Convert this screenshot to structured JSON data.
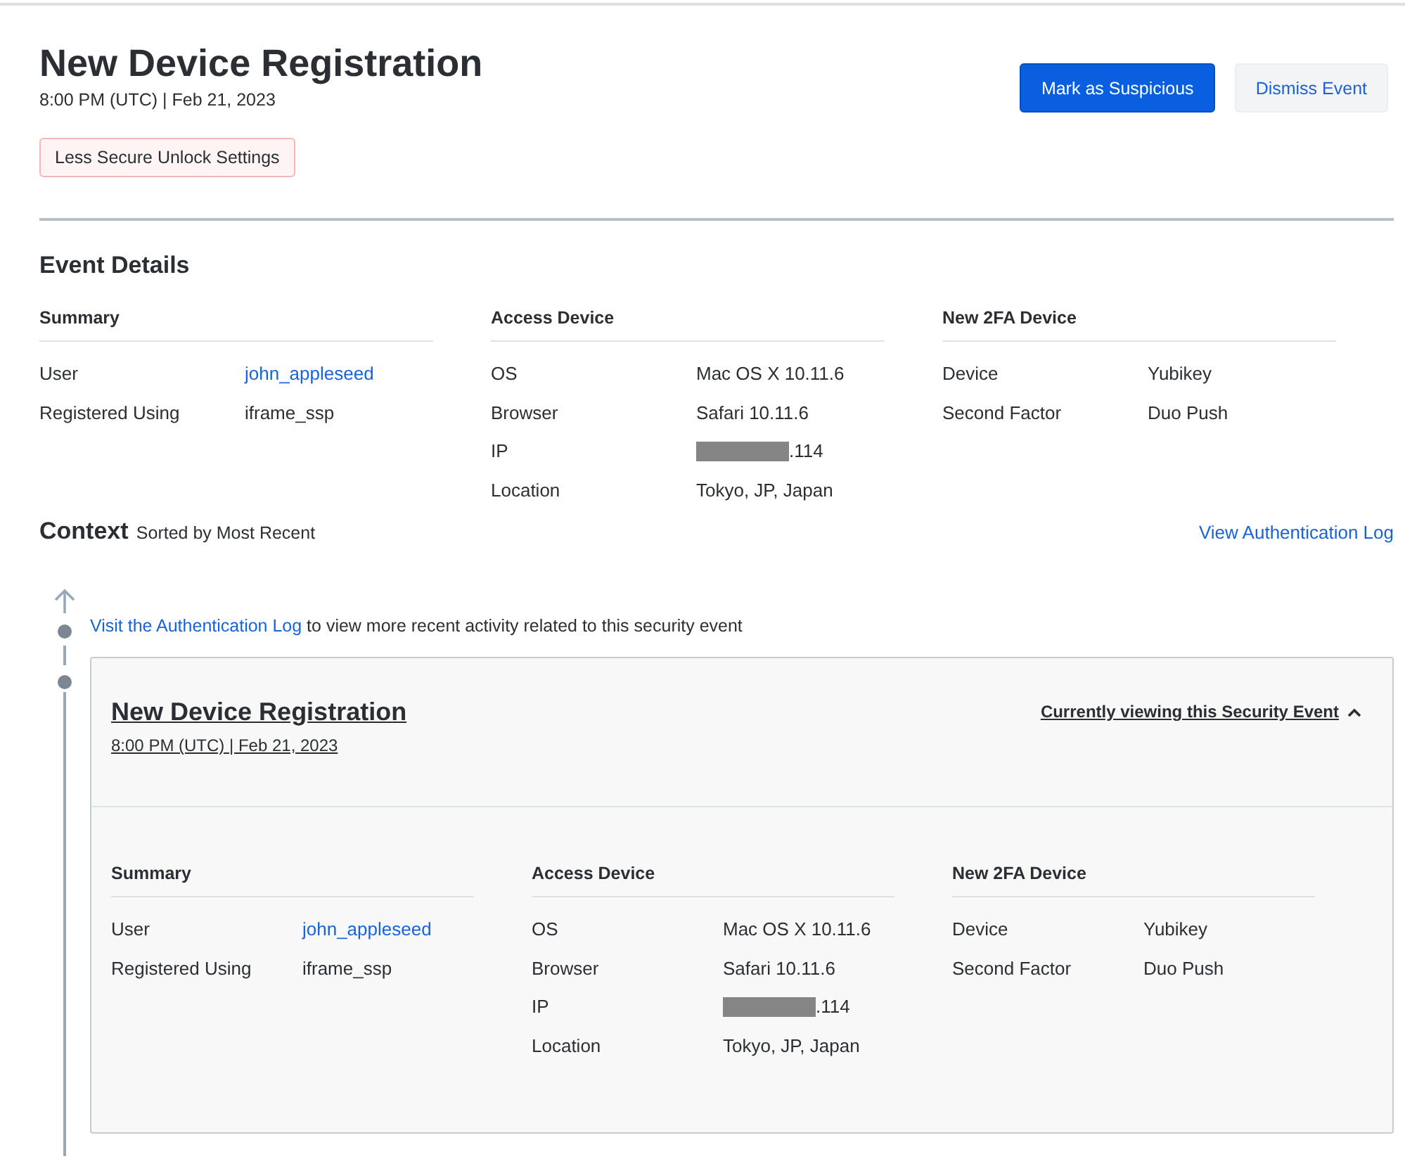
{
  "header": {
    "title": "New Device Registration",
    "timestamp": "8:00 PM (UTC) | Feb 21, 2023",
    "tag": "Less Secure Unlock Settings"
  },
  "actions": [
    {
      "label": "Mark as Suspicious",
      "kind": "primary"
    },
    {
      "label": "Dismiss Event",
      "kind": "secondary"
    }
  ],
  "event_details": {
    "title": "Event Details",
    "sections": [
      {
        "title": "Summary",
        "rows": [
          {
            "label": "User",
            "value": "john_appleseed",
            "kind": "link"
          },
          {
            "label": "Registered Using",
            "value": "iframe_ssp",
            "kind": "text"
          }
        ]
      },
      {
        "title": "Access Device",
        "rows": [
          {
            "label": "OS",
            "value": "Mac OS X 10.11.6",
            "kind": "text"
          },
          {
            "label": "Browser",
            "value": "Safari 10.11.6",
            "kind": "text"
          },
          {
            "label": "IP",
            "value": ".114",
            "kind": "redacted"
          },
          {
            "label": "Location",
            "value": "Tokyo, JP, Japan",
            "kind": "text"
          }
        ]
      },
      {
        "title": "New 2FA Device",
        "rows": [
          {
            "label": "Device",
            "value": "Yubikey",
            "kind": "text"
          },
          {
            "label": "Second Factor",
            "value": "Duo Push",
            "kind": "text"
          }
        ]
      }
    ]
  },
  "context": {
    "title": "Context",
    "subtitle": "Sorted by Most Recent",
    "log_link": "View Authentication Log",
    "notice": {
      "link": "Visit the Authentication Log",
      "text": "to view more recent activity related to this security event"
    },
    "event_card": {
      "title": "New Device Registration",
      "timestamp": "8:00 PM (UTC) | Feb 21, 2023",
      "toggle": "Currently viewing this Security Event",
      "expanded": true,
      "sections": [
        {
          "title": "Summary",
          "rows": [
            {
              "label": "User",
              "value": "john_appleseed",
              "kind": "link"
            },
            {
              "label": "Registered Using",
              "value": "iframe_ssp",
              "kind": "text"
            }
          ]
        },
        {
          "title": "Access Device",
          "rows": [
            {
              "label": "OS",
              "value": "Mac OS X 10.11.6",
              "kind": "text"
            },
            {
              "label": "Browser",
              "value": "Safari 10.11.6",
              "kind": "text"
            },
            {
              "label": "IP",
              "value": ".114",
              "kind": "redacted"
            },
            {
              "label": "Location",
              "value": "Tokyo, JP, Japan",
              "kind": "text"
            }
          ]
        },
        {
          "title": "New 2FA Device",
          "rows": [
            {
              "label": "Device",
              "value": "Yubikey",
              "kind": "text"
            },
            {
              "label": "Second Factor",
              "value": "Duo Push",
              "kind": "text"
            }
          ]
        }
      ]
    }
  }
}
